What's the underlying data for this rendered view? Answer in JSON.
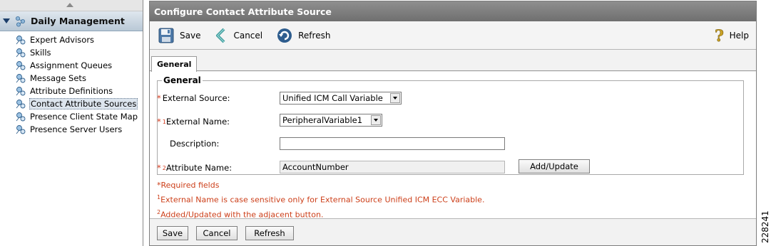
{
  "sidebar": {
    "header_label": "Daily Management",
    "items": [
      {
        "label": "Expert Advisors",
        "selected": false
      },
      {
        "label": "Skills",
        "selected": false
      },
      {
        "label": "Assignment Queues",
        "selected": false
      },
      {
        "label": "Message Sets",
        "selected": false
      },
      {
        "label": "Attribute Definitions",
        "selected": false
      },
      {
        "label": "Contact Attribute Sources",
        "selected": true
      },
      {
        "label": "Presence Client State Map",
        "selected": false
      },
      {
        "label": "Presence Server Users",
        "selected": false
      }
    ]
  },
  "main": {
    "title": "Configure Contact Attribute Source",
    "toolbar": {
      "save_label": "Save",
      "cancel_label": "Cancel",
      "refresh_label": "Refresh",
      "help_label": "Help"
    },
    "tabs": [
      {
        "label": "General",
        "active": true
      }
    ],
    "group_title": "General",
    "form": {
      "external_source_label": "External Source:",
      "external_source_value": "Unified ICM Call Variable",
      "external_name_label": "External Name:",
      "external_name_value": "PeripheralVariable1",
      "description_label": "Description:",
      "description_value": "",
      "attribute_name_label": "Attribute Name:",
      "attribute_name_value": "AccountNumber",
      "add_update_label": "Add/Update",
      "required_mark": "*",
      "footnote1_mark": "1",
      "footnote2_mark": "2"
    },
    "notes": {
      "required": "Required fields",
      "note1": "External Name is case sensitive only for External Source Unified ICM ECC Variable.",
      "note2": "Added/Updated with the adjacent button."
    },
    "footer": {
      "save_label": "Save",
      "cancel_label": "Cancel",
      "refresh_label": "Refresh"
    }
  },
  "figure_code": "228241",
  "colors": {
    "required_red": "#d43a1c",
    "title_bar": "#7a7a7a",
    "selected_item_bg": "#dde5ee"
  }
}
